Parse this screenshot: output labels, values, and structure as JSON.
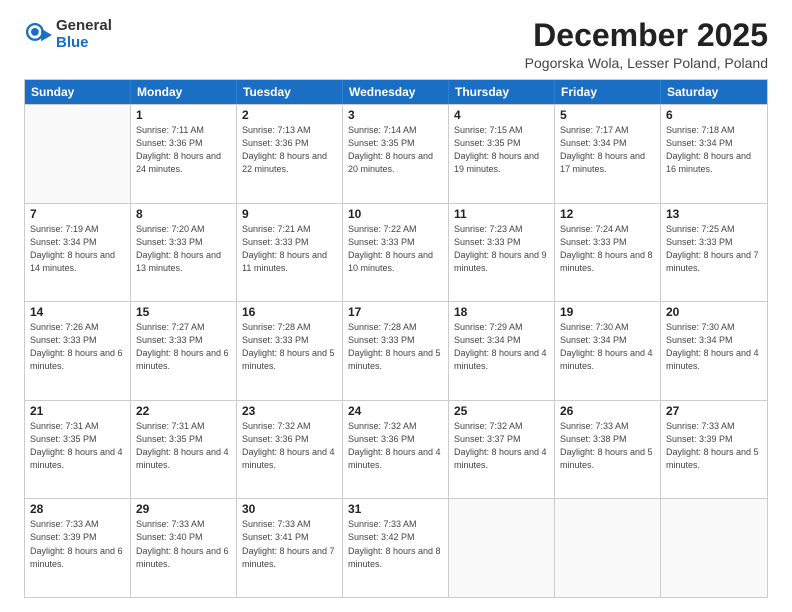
{
  "logo": {
    "general": "General",
    "blue": "Blue"
  },
  "title": "December 2025",
  "subtitle": "Pogorska Wola, Lesser Poland, Poland",
  "headers": [
    "Sunday",
    "Monday",
    "Tuesday",
    "Wednesday",
    "Thursday",
    "Friday",
    "Saturday"
  ],
  "weeks": [
    [
      {
        "num": "",
        "empty": true
      },
      {
        "num": "1",
        "sunrise": "7:11 AM",
        "sunset": "3:36 PM",
        "daylight": "8 hours and 24 minutes."
      },
      {
        "num": "2",
        "sunrise": "7:13 AM",
        "sunset": "3:36 PM",
        "daylight": "8 hours and 22 minutes."
      },
      {
        "num": "3",
        "sunrise": "7:14 AM",
        "sunset": "3:35 PM",
        "daylight": "8 hours and 20 minutes."
      },
      {
        "num": "4",
        "sunrise": "7:15 AM",
        "sunset": "3:35 PM",
        "daylight": "8 hours and 19 minutes."
      },
      {
        "num": "5",
        "sunrise": "7:17 AM",
        "sunset": "3:34 PM",
        "daylight": "8 hours and 17 minutes."
      },
      {
        "num": "6",
        "sunrise": "7:18 AM",
        "sunset": "3:34 PM",
        "daylight": "8 hours and 16 minutes."
      }
    ],
    [
      {
        "num": "7",
        "sunrise": "7:19 AM",
        "sunset": "3:34 PM",
        "daylight": "8 hours and 14 minutes."
      },
      {
        "num": "8",
        "sunrise": "7:20 AM",
        "sunset": "3:33 PM",
        "daylight": "8 hours and 13 minutes."
      },
      {
        "num": "9",
        "sunrise": "7:21 AM",
        "sunset": "3:33 PM",
        "daylight": "8 hours and 11 minutes."
      },
      {
        "num": "10",
        "sunrise": "7:22 AM",
        "sunset": "3:33 PM",
        "daylight": "8 hours and 10 minutes."
      },
      {
        "num": "11",
        "sunrise": "7:23 AM",
        "sunset": "3:33 PM",
        "daylight": "8 hours and 9 minutes."
      },
      {
        "num": "12",
        "sunrise": "7:24 AM",
        "sunset": "3:33 PM",
        "daylight": "8 hours and 8 minutes."
      },
      {
        "num": "13",
        "sunrise": "7:25 AM",
        "sunset": "3:33 PM",
        "daylight": "8 hours and 7 minutes."
      }
    ],
    [
      {
        "num": "14",
        "sunrise": "7:26 AM",
        "sunset": "3:33 PM",
        "daylight": "8 hours and 6 minutes."
      },
      {
        "num": "15",
        "sunrise": "7:27 AM",
        "sunset": "3:33 PM",
        "daylight": "8 hours and 6 minutes."
      },
      {
        "num": "16",
        "sunrise": "7:28 AM",
        "sunset": "3:33 PM",
        "daylight": "8 hours and 5 minutes."
      },
      {
        "num": "17",
        "sunrise": "7:28 AM",
        "sunset": "3:33 PM",
        "daylight": "8 hours and 5 minutes."
      },
      {
        "num": "18",
        "sunrise": "7:29 AM",
        "sunset": "3:34 PM",
        "daylight": "8 hours and 4 minutes."
      },
      {
        "num": "19",
        "sunrise": "7:30 AM",
        "sunset": "3:34 PM",
        "daylight": "8 hours and 4 minutes."
      },
      {
        "num": "20",
        "sunrise": "7:30 AM",
        "sunset": "3:34 PM",
        "daylight": "8 hours and 4 minutes."
      }
    ],
    [
      {
        "num": "21",
        "sunrise": "7:31 AM",
        "sunset": "3:35 PM",
        "daylight": "8 hours and 4 minutes."
      },
      {
        "num": "22",
        "sunrise": "7:31 AM",
        "sunset": "3:35 PM",
        "daylight": "8 hours and 4 minutes."
      },
      {
        "num": "23",
        "sunrise": "7:32 AM",
        "sunset": "3:36 PM",
        "daylight": "8 hours and 4 minutes."
      },
      {
        "num": "24",
        "sunrise": "7:32 AM",
        "sunset": "3:36 PM",
        "daylight": "8 hours and 4 minutes."
      },
      {
        "num": "25",
        "sunrise": "7:32 AM",
        "sunset": "3:37 PM",
        "daylight": "8 hours and 4 minutes."
      },
      {
        "num": "26",
        "sunrise": "7:33 AM",
        "sunset": "3:38 PM",
        "daylight": "8 hours and 5 minutes."
      },
      {
        "num": "27",
        "sunrise": "7:33 AM",
        "sunset": "3:39 PM",
        "daylight": "8 hours and 5 minutes."
      }
    ],
    [
      {
        "num": "28",
        "sunrise": "7:33 AM",
        "sunset": "3:39 PM",
        "daylight": "8 hours and 6 minutes."
      },
      {
        "num": "29",
        "sunrise": "7:33 AM",
        "sunset": "3:40 PM",
        "daylight": "8 hours and 6 minutes."
      },
      {
        "num": "30",
        "sunrise": "7:33 AM",
        "sunset": "3:41 PM",
        "daylight": "8 hours and 7 minutes."
      },
      {
        "num": "31",
        "sunrise": "7:33 AM",
        "sunset": "3:42 PM",
        "daylight": "8 hours and 8 minutes."
      },
      {
        "num": "",
        "empty": true
      },
      {
        "num": "",
        "empty": true
      },
      {
        "num": "",
        "empty": true
      }
    ]
  ],
  "labels": {
    "sunrise": "Sunrise:",
    "sunset": "Sunset:",
    "daylight": "Daylight:"
  }
}
